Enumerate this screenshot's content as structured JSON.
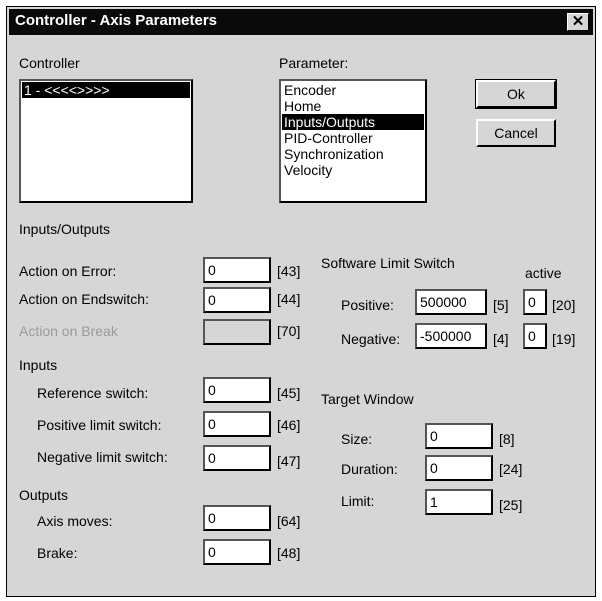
{
  "window": {
    "title": "Controller - Axis Parameters",
    "close_glyph": "✕"
  },
  "controller": {
    "label": "Controller",
    "items": [
      "1 - <<<<>>>>"
    ]
  },
  "parameter": {
    "label": "Parameter:",
    "items": [
      "Encoder",
      "Home",
      "Inputs/Outputs",
      "PID-Controller",
      "Synchronization",
      "Velocity"
    ],
    "selected": "Inputs/Outputs"
  },
  "buttons": {
    "ok": "Ok",
    "cancel": "Cancel"
  },
  "io": {
    "section_label": "Inputs/Outputs",
    "action_on_error": {
      "label": "Action on Error:",
      "value": "0",
      "code": "[43]"
    },
    "action_on_endswitch": {
      "label": "Action on Endswitch:",
      "value": "0",
      "code": "[44]"
    },
    "action_on_break": {
      "label": "Action on Break",
      "value": "",
      "code": "[70]"
    }
  },
  "inputs": {
    "label": "Inputs",
    "reference_switch": {
      "label": "Reference switch:",
      "value": "0",
      "code": "[45]"
    },
    "positive_limit_switch": {
      "label": "Positive limit switch:",
      "value": "0",
      "code": "[46]"
    },
    "negative_limit_switch": {
      "label": "Negative limit switch:",
      "value": "0",
      "code": "[47]"
    }
  },
  "outputs": {
    "label": "Outputs",
    "axis_moves": {
      "label": "Axis moves:",
      "value": "0",
      "code": "[64]"
    },
    "brake": {
      "label": "Brake:",
      "value": "0",
      "code": "[48]"
    }
  },
  "software_limit": {
    "label": "Software Limit Switch",
    "active_label": "active",
    "positive": {
      "label": "Positive:",
      "value": "500000",
      "code": "[5]",
      "active_value": "0",
      "active_code": "[20]"
    },
    "negative": {
      "label": "Negative:",
      "value": "-500000",
      "code": "[4]",
      "active_value": "0",
      "active_code": "[19]"
    }
  },
  "target_window": {
    "label": "Target Window",
    "size": {
      "label": "Size:",
      "value": "0",
      "code": "[8]"
    },
    "duration": {
      "label": "Duration:",
      "value": "0",
      "code": "[24]"
    },
    "limit": {
      "label": "Limit:",
      "value": "1",
      "code": "[25]"
    }
  }
}
